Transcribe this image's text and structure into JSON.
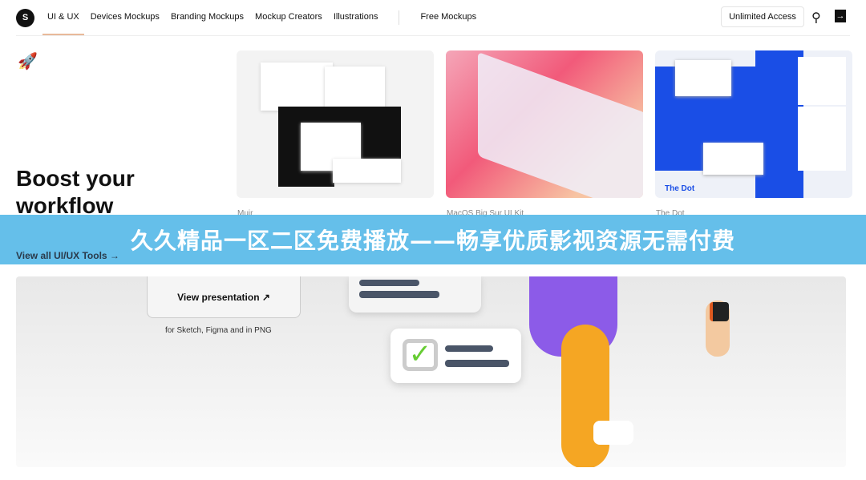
{
  "nav": {
    "logo": "S",
    "items": [
      "UI & UX",
      "Devices Mockups",
      "Branding Mockups",
      "Mockup Creators",
      "Illustrations"
    ],
    "free": "Free Mockups",
    "unlimited": "Unlimited Access",
    "icons": [
      "search-icon",
      "login-icon"
    ]
  },
  "hero": {
    "title": "Boost your workflow",
    "view_all": "View all UI/UX Tools →",
    "view_presentation": "View presentation ↗",
    "subtitle": "for Sketch, Figma and in PNG"
  },
  "cards": [
    {
      "caption": "Muir"
    },
    {
      "caption": "MacOS Big Sur UI Kit"
    },
    {
      "caption": "The Dot"
    }
  ],
  "banner": {
    "text": "久久精品一区二区免费播放——畅享优质影视资源无需付费"
  },
  "colors": {
    "banner": "#54b8e8",
    "accent": "#e9b99a",
    "dot_blue": "#1a4ee6"
  }
}
